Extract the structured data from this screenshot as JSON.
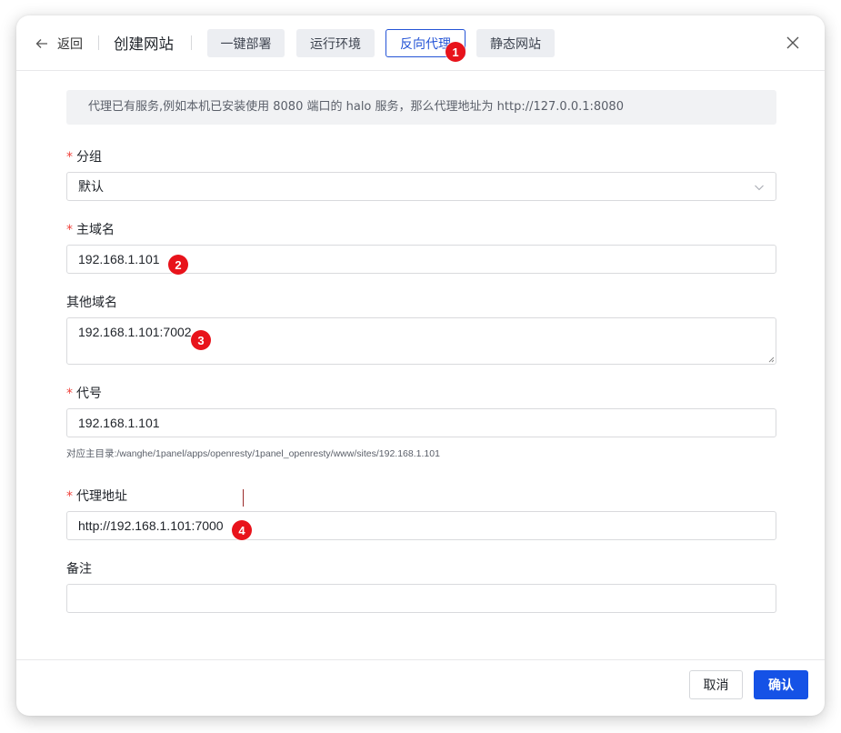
{
  "header": {
    "back_label": "返回",
    "title": "创建网站",
    "tabs": [
      {
        "label": "一键部署",
        "active": false
      },
      {
        "label": "运行环境",
        "active": false
      },
      {
        "label": "反向代理",
        "active": true
      },
      {
        "label": "静态网站",
        "active": false
      }
    ]
  },
  "alert_text": "代理已有服务,例如本机已安装使用 8080 端口的 halo 服务，那么代理地址为 http://127.0.0.1:8080",
  "form": {
    "group": {
      "label": "分组",
      "required": "*",
      "value": "默认"
    },
    "primary_domain": {
      "label": "主域名",
      "required": "*",
      "value": "192.168.1.101"
    },
    "other_domains": {
      "label": "其他域名",
      "value": "192.168.1.101:7002"
    },
    "alias": {
      "label": "代号",
      "required": "*",
      "value": "192.168.1.101",
      "hint": "对应主目录:/wanghe/1panel/apps/openresty/1panel_openresty/www/sites/192.168.1.101"
    },
    "proxy_address": {
      "label": "代理地址",
      "required": "*",
      "value": "http://192.168.1.101:7000"
    },
    "remark": {
      "label": "备注",
      "value": ""
    }
  },
  "footer": {
    "cancel_label": "取消",
    "confirm_label": "确认"
  },
  "markers": [
    "1",
    "2",
    "3",
    "4"
  ],
  "colors": {
    "accent": "#1552e6",
    "marker": "#e8131b",
    "required": "#f0423b"
  },
  "icons": [
    "arrow-left-icon",
    "close-icon",
    "chevron-down-icon"
  ]
}
